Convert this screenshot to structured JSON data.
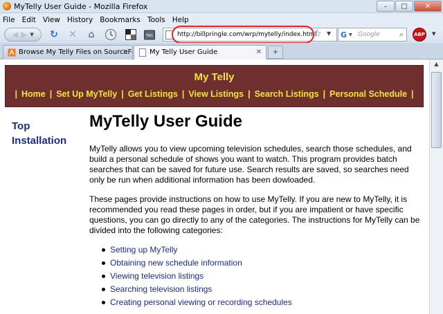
{
  "window": {
    "title": "MyTelly User Guide - Mozilla Firefox"
  },
  "menu": [
    "File",
    "Edit",
    "View",
    "History",
    "Bookmarks",
    "Tools",
    "Help"
  ],
  "toolbar": {
    "url": "http://billpringle.com/wrp/mytelly/index.html",
    "search_placeholder": "Google",
    "search_engine_glyph": "G",
    "adblock_label": "ABP"
  },
  "tabs": [
    {
      "label": "Browse My Telly Files on SourceFor...",
      "active": false
    },
    {
      "label": "My Telly User Guide",
      "active": true
    }
  ],
  "page": {
    "site_title": "My Telly",
    "nav": [
      "Home",
      "Set Up MyTelly",
      "Get Listings",
      "View Listings",
      "Search Listings",
      "Personal Schedule"
    ],
    "sidebar": [
      "Top",
      "Installation"
    ],
    "heading": "MyTelly User Guide",
    "paragraphs": [
      "MyTelly allows you to view upcoming television schedules, search those schedules, and build a personal schedule of shows you want to watch. This program provides batch searches that can be saved for future use. Search results are saved, so searches need only be run when additional information has been dowloaded.",
      "These pages provide instructions on how to use MyTelly. If you are new to MyTelly, it is recommended you read these pages in order, but if you are impatient or have specific questions, you can go directly to any of the categories. The instructions for MyTelly can be divided into the following categories:"
    ],
    "categories": [
      "Setting up MyTelly",
      "Obtaining new schedule information",
      "Viewing television listings",
      "Searching television listings",
      "Creating personal viewing or recording schedules"
    ]
  },
  "colors": {
    "banner_bg": "#6f2f2f",
    "banner_text": "#f3e23a",
    "link": "#1d2a86",
    "highlight_oval": "#e0262b"
  }
}
